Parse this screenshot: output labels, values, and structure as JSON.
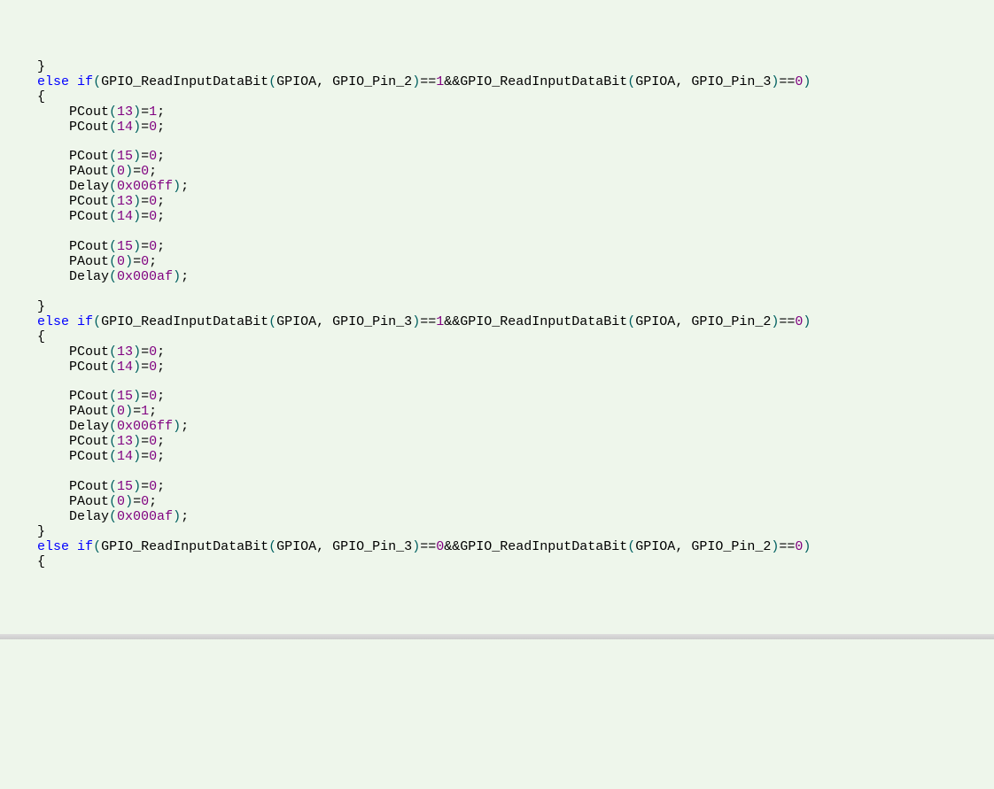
{
  "keywords": {
    "else": "else",
    "if": "if"
  },
  "tokens": {
    "gpio_read": "GPIO_ReadInputDataBit",
    "gpioa": "GPIOA",
    "gpio_pin_2": "GPIO_Pin_2",
    "gpio_pin_3": "GPIO_Pin_3",
    "pcout": "PCout",
    "paout": "PAout",
    "delay": "Delay",
    "comma": ",",
    "space": " ",
    "lparen": "(",
    "rparen": ")",
    "semi": ";",
    "lbrace": "{",
    "rbrace": "}",
    "eqeq": "==",
    "andand": "&&",
    "eq": "="
  },
  "nums": {
    "n0": "0",
    "n1": "1",
    "n13": "13",
    "n14": "14",
    "n15": "15",
    "h006ff": "0x006ff",
    "h000af": "0x000af"
  },
  "indent": {
    "i1": "    ",
    "i2": "        "
  }
}
